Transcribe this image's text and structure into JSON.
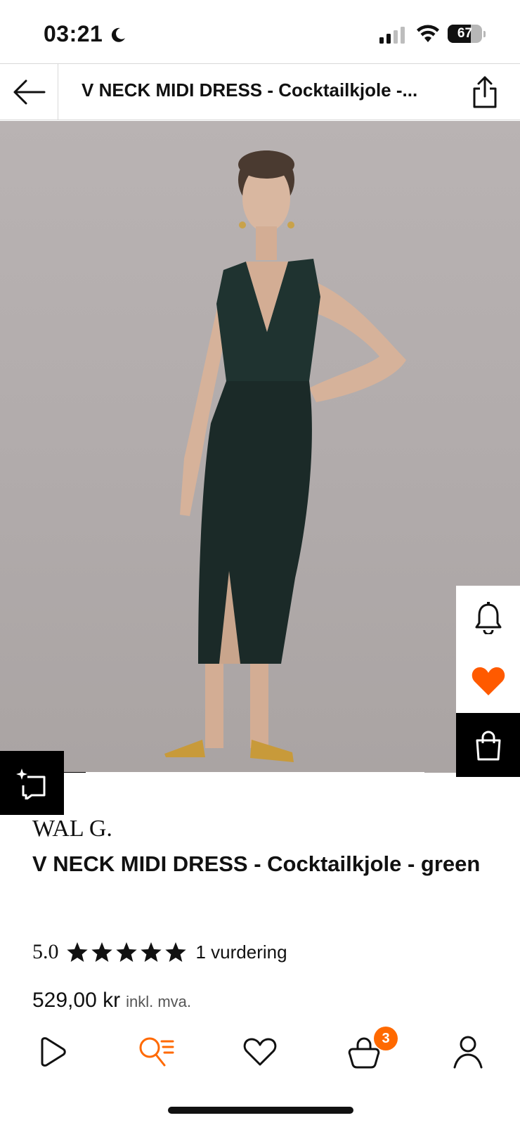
{
  "status_bar": {
    "time": "03:21",
    "battery": "67",
    "battery_level": 0.67
  },
  "header": {
    "title": "V NECK MIDI DRESS - Cocktailkjole -...",
    "back_icon": "arrow-left-icon",
    "share_icon": "share-icon"
  },
  "gallery": {
    "image_progress": 0.06
  },
  "side_actions": {
    "notify_icon": "bell-icon",
    "favorite_icon": "heart-filled-icon",
    "bag_icon": "shopping-bag-icon",
    "ar_icon": "ai-try-on-icon"
  },
  "product": {
    "brand": "WAL G.",
    "title": "V NECK MIDI DRESS - Cocktailkjole - green",
    "rating_score": "5.0",
    "stars": 5,
    "rating_count": "1 vurdering",
    "price": "529,00 kr",
    "vat_note": "inkl. mva."
  },
  "bottom_nav": {
    "cart_count": "3",
    "items": [
      "play-icon",
      "search-icon",
      "heart-icon",
      "cart-icon",
      "profile-icon"
    ],
    "active_color": "#ff6900"
  },
  "colors": {
    "accent": "#ff6900",
    "text": "#111111"
  }
}
